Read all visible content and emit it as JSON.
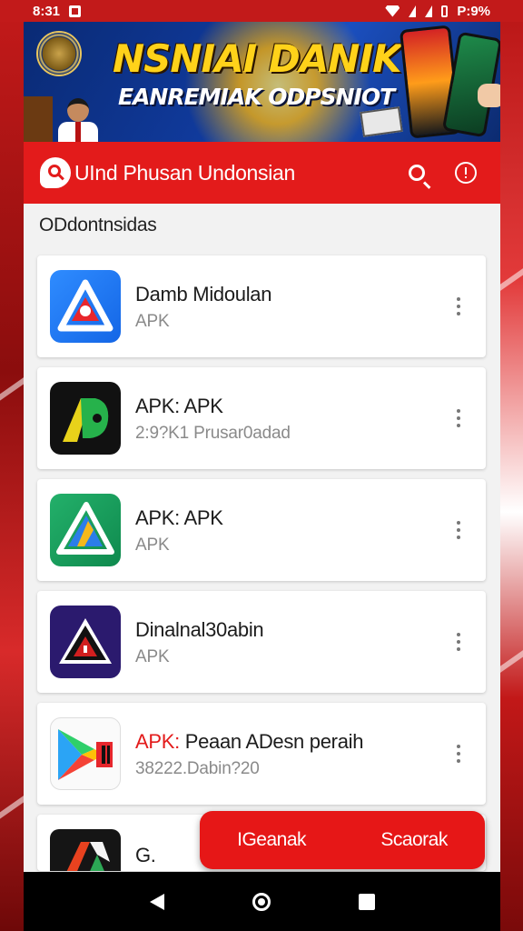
{
  "status_bar": {
    "time": "8:31",
    "right_text": "P:9%"
  },
  "banner": {
    "headline": "NSNIAI DANIK",
    "subline": "EANREMIAK ODPSNIOT"
  },
  "app_bar": {
    "title": "UInd Phusan Undonsian",
    "icons": [
      "search-icon",
      "alert-icon"
    ],
    "color": "#e31b1b"
  },
  "section": {
    "title": "ODdontnsidas"
  },
  "apps": [
    {
      "name": "Damb Midoulan",
      "subtitle": "APK",
      "icon": "blue-triangle-icon"
    },
    {
      "name": "APK: APK",
      "subtitle": "2:9?K1 Prusar0adad",
      "icon": "green-yellow-leaf-icon"
    },
    {
      "name": "APK: APK",
      "subtitle": "APK",
      "icon": "triangle-logo-icon"
    },
    {
      "name": "Dinalnal30abin",
      "subtitle": "APK",
      "icon": "red-star-triangle-icon"
    },
    {
      "name_prefix": "APK:",
      "name_rest": "Peaan ADesn peraih",
      "subtitle": "38222.Dabin?20",
      "icon": "play-store-icon"
    },
    {
      "name": "G.",
      "subtitle": "",
      "icon": "dark-triangle-icon"
    }
  ],
  "action_bar": {
    "left_label": "IGeanak",
    "right_label": "Scaorak",
    "color": "#e61717"
  },
  "nav_bar": {
    "icons": [
      "back-icon",
      "home-icon",
      "recents-icon"
    ]
  }
}
